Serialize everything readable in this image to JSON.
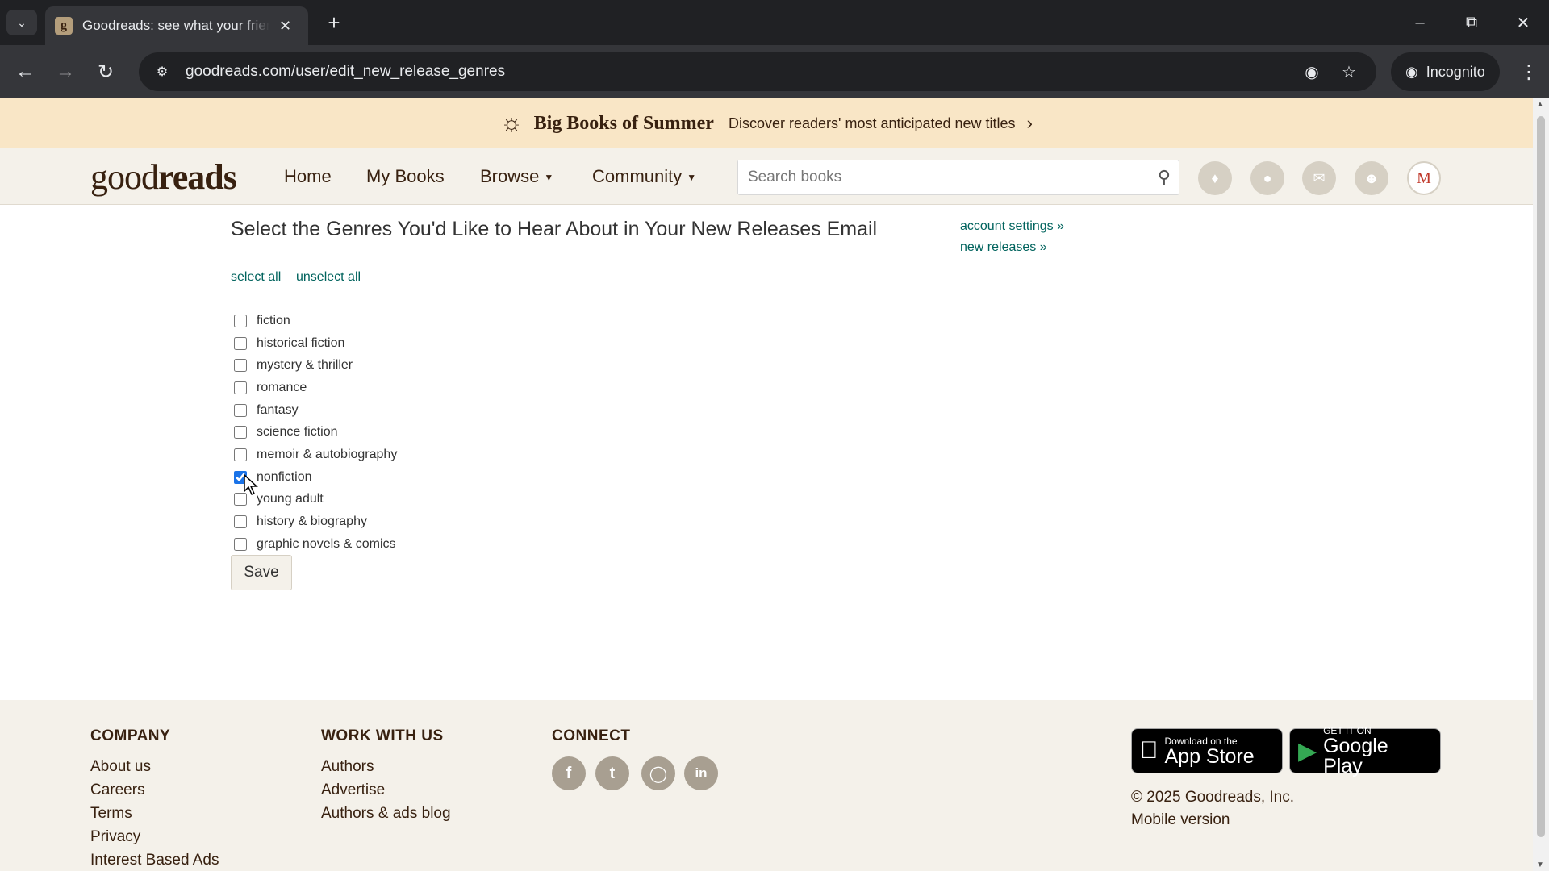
{
  "browser": {
    "tab_title": "Goodreads: see what your friends are reading",
    "tab_favicon": "g",
    "url": "goodreads.com/user/edit_new_release_genres",
    "incognito_label": "Incognito"
  },
  "promo": {
    "title": "Big Books of Summer",
    "text": "Discover readers' most anticipated new titles",
    "icon": "sun-book-icon"
  },
  "header": {
    "logo_light": "good",
    "logo_bold": "reads",
    "nav": [
      {
        "label": "Home"
      },
      {
        "label": "My Books"
      },
      {
        "label": "Browse"
      },
      {
        "label": "Community"
      }
    ],
    "search_placeholder": "Search books",
    "avatar_initial": "M"
  },
  "main": {
    "title": "Select the Genres You'd Like to Hear About in Your New Releases Email",
    "select_all": "select all",
    "unselect_all": "unselect all",
    "side_links": [
      "account settings »",
      "new releases »"
    ],
    "genres": [
      {
        "label": "fiction",
        "checked": false
      },
      {
        "label": "historical fiction",
        "checked": false
      },
      {
        "label": "mystery & thriller",
        "checked": false
      },
      {
        "label": "romance",
        "checked": false
      },
      {
        "label": "fantasy",
        "checked": false
      },
      {
        "label": "science fiction",
        "checked": false
      },
      {
        "label": "memoir & autobiography",
        "checked": false
      },
      {
        "label": "nonfiction",
        "checked": true
      },
      {
        "label": "young adult",
        "checked": false
      },
      {
        "label": "history & biography",
        "checked": false
      },
      {
        "label": "graphic novels & comics",
        "checked": false
      }
    ],
    "save_label": "Save"
  },
  "footer": {
    "company_heading": "COMPANY",
    "company_links": [
      "About us",
      "Careers",
      "Terms",
      "Privacy",
      "Interest Based Ads"
    ],
    "work_heading": "WORK WITH US",
    "work_links": [
      "Authors",
      "Advertise",
      "Authors & ads blog"
    ],
    "connect_heading": "CONNECT",
    "social": [
      "facebook-icon",
      "twitter-icon",
      "instagram-icon",
      "linkedin-icon"
    ],
    "app_store_small": "Download on the",
    "app_store_big": "App Store",
    "google_play_small": "GET IT ON",
    "google_play_big": "Google Play",
    "copyright": "© 2025 Goodreads, Inc.",
    "mobile_version": "Mobile version"
  },
  "colors": {
    "promo_bg": "#f9e6c6",
    "header_bg": "#f4f1ea",
    "brand_brown": "#382110",
    "link_green": "#00635d",
    "checkbox_accent": "#1a73e8"
  }
}
